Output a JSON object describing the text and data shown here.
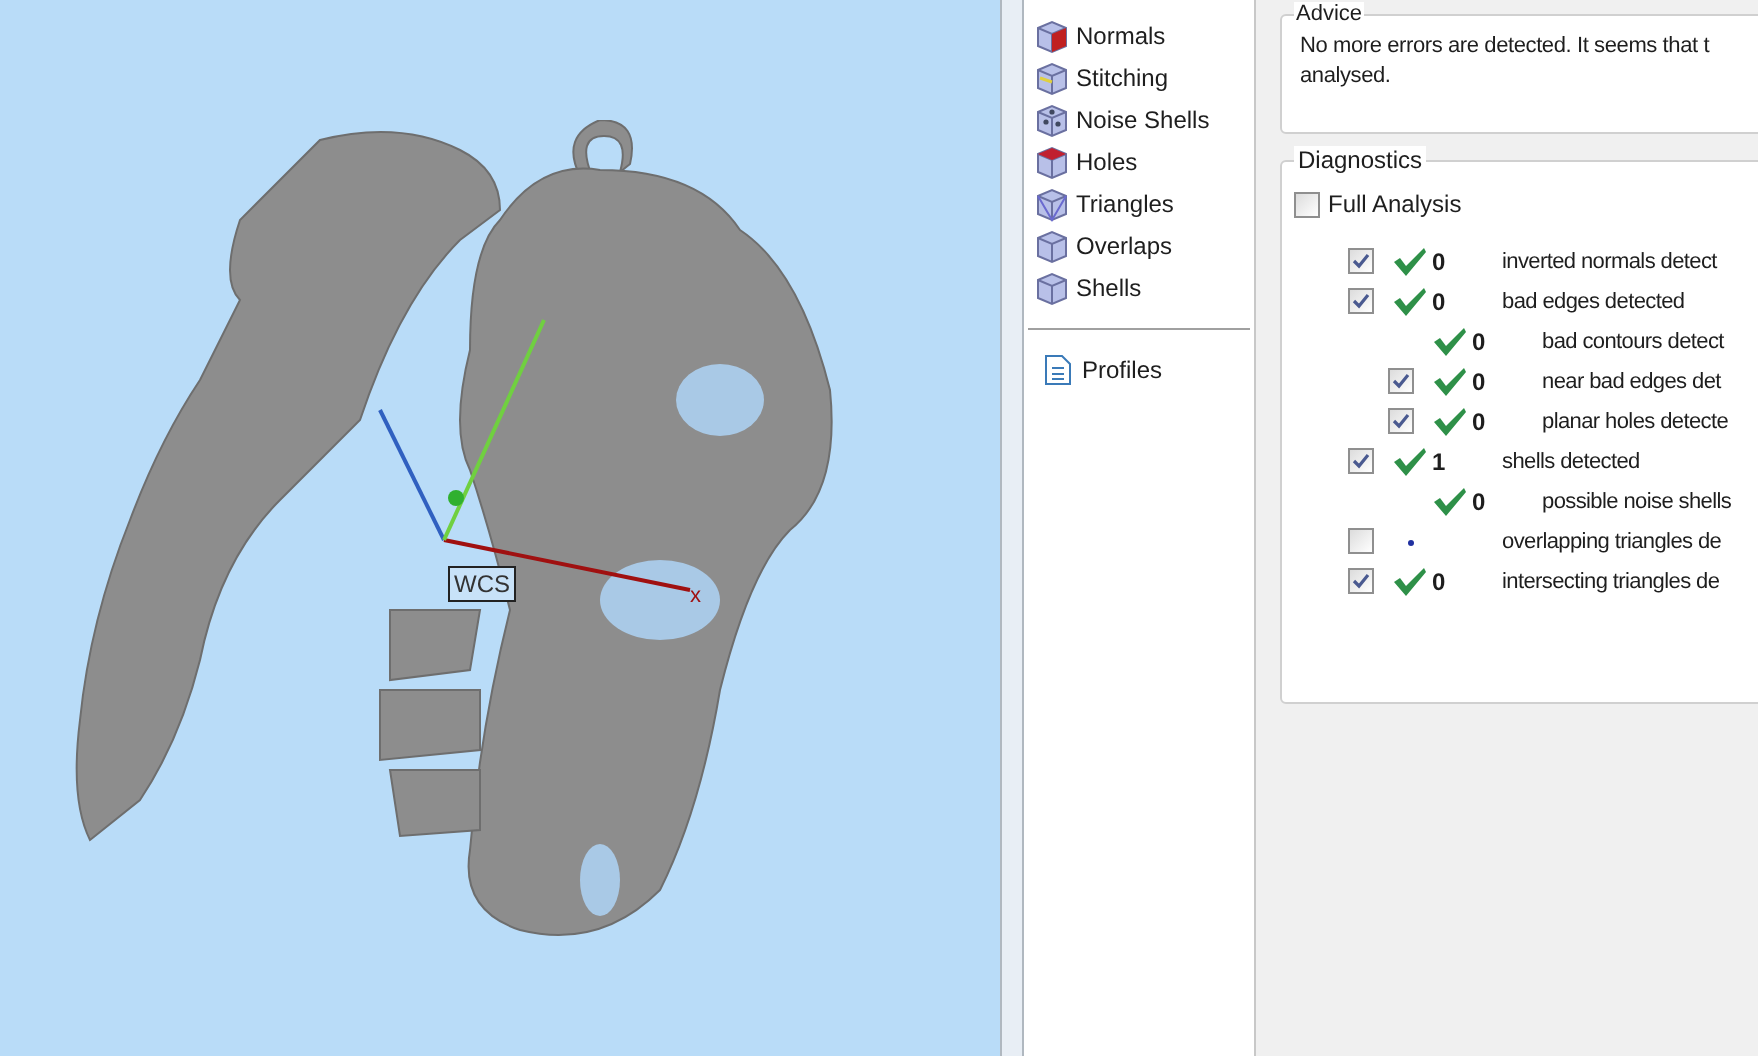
{
  "viewport": {
    "axis_label": "x",
    "frame_label": "WCS"
  },
  "tools": [
    {
      "label": "Normals",
      "kind": "normals"
    },
    {
      "label": "Stitching",
      "kind": "stitching"
    },
    {
      "label": "Noise Shells",
      "kind": "noise"
    },
    {
      "label": "Holes",
      "kind": "holes"
    },
    {
      "label": "Triangles",
      "kind": "triangles"
    },
    {
      "label": "Overlaps",
      "kind": "overlaps"
    },
    {
      "label": "Shells",
      "kind": "shells"
    }
  ],
  "profiles": {
    "label": "Profiles"
  },
  "advice": {
    "title": "Advice",
    "text": "No more errors are detected. It seems that t",
    "text_2": "analysed."
  },
  "diagnostics": {
    "title": "Diagnostics",
    "full_analysis": {
      "label": "Full Analysis",
      "checked": false
    },
    "rows": [
      {
        "checked": true,
        "kind": "check",
        "count": "0",
        "label": "inverted normals detect"
      },
      {
        "checked": true,
        "kind": "check",
        "count": "0",
        "label": "bad edges detected",
        "children": [
          {
            "kind": "check",
            "count": "0",
            "label": "bad contours detect"
          },
          {
            "checked": true,
            "kind": "check",
            "count": "0",
            "label": "near bad edges det"
          },
          {
            "checked": true,
            "kind": "check",
            "count": "0",
            "label": "planar holes detecte"
          }
        ]
      },
      {
        "checked": true,
        "kind": "check",
        "count": "1",
        "label": "shells detected",
        "children": [
          {
            "kind": "check",
            "count": "0",
            "label": "possible noise shells"
          }
        ]
      },
      {
        "checked": false,
        "kind": "dot",
        "label": "overlapping triangles de"
      },
      {
        "checked": true,
        "kind": "check",
        "count": "0",
        "label": "intersecting triangles de"
      }
    ]
  }
}
